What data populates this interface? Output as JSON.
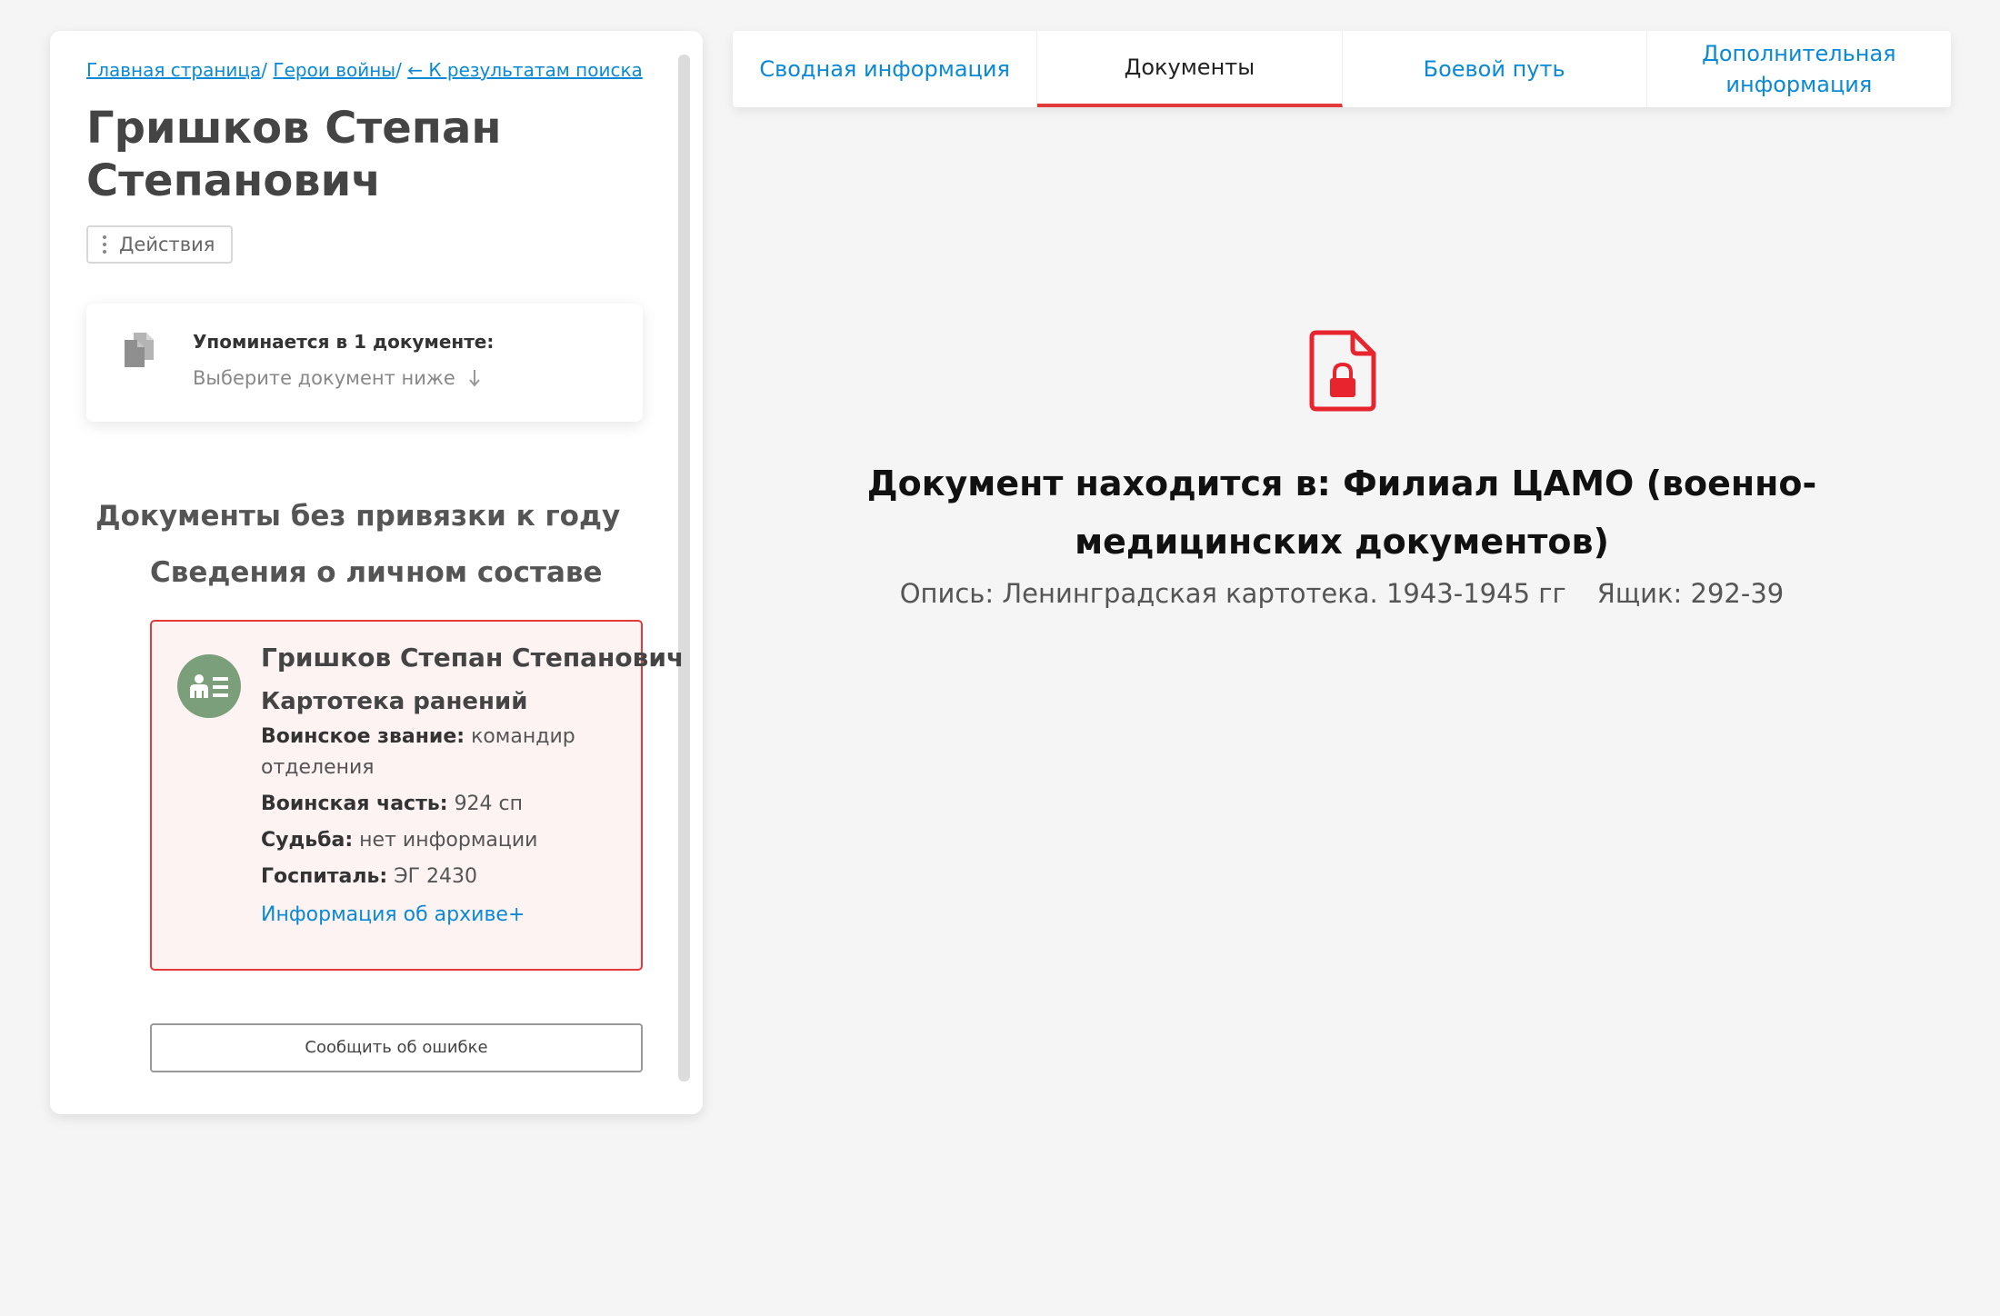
{
  "breadcrumb": {
    "home": "Главная страница",
    "heroes": "Герои войны",
    "back": "← К результатам поиска",
    "separator": "/"
  },
  "person": {
    "name": "Гришков Степан Степанович"
  },
  "actions": {
    "label": "Действия"
  },
  "mentions": {
    "title": "Упоминается в 1 документе:",
    "hint": "Выберите документ ниже"
  },
  "documents_section": {
    "heading": "Документы без привязки к году",
    "subheading": "Сведения о личном составе"
  },
  "record": {
    "name": "Гришков Степан Степанович",
    "type": "Картотека ранений",
    "rank_label": "Воинское звание:",
    "rank_value": "командир отделения",
    "unit_label": "Воинская часть:",
    "unit_value": "924 сп",
    "fate_label": "Судьба:",
    "fate_value": "нет информации",
    "hospital_label": "Госпиталь:",
    "hospital_value": "ЭГ 2430",
    "archive_link": "Информация об архиве+"
  },
  "report_error": {
    "label": "Сообщить об ошибке"
  },
  "tabs": [
    {
      "label": "Сводная информация",
      "active": false
    },
    {
      "label": "Документы",
      "active": true
    },
    {
      "label": "Боевой путь",
      "active": false
    },
    {
      "label": "Дополнительная информация",
      "active": false
    }
  ],
  "document": {
    "location": "Документ находится в: Филиал ЦАМО (военно-медицинских документов)",
    "inventory": "Опись: Ленинградская картотека. 1943-1945 гг",
    "box": "Ящик: 292-39"
  },
  "icons": {
    "documents": "doc-stack-icon",
    "arrow": "arrow-down-icon",
    "record": "person-card-icon",
    "locked": "lock-file-icon",
    "menu": "kebab-icon"
  },
  "colors": {
    "accent_red": "#e33b3b",
    "link_blue": "#0a8ad6",
    "record_icon_green": "#7a9f7a",
    "record_bg": "#fdf3f3",
    "page_bg": "#f5f5f5"
  }
}
